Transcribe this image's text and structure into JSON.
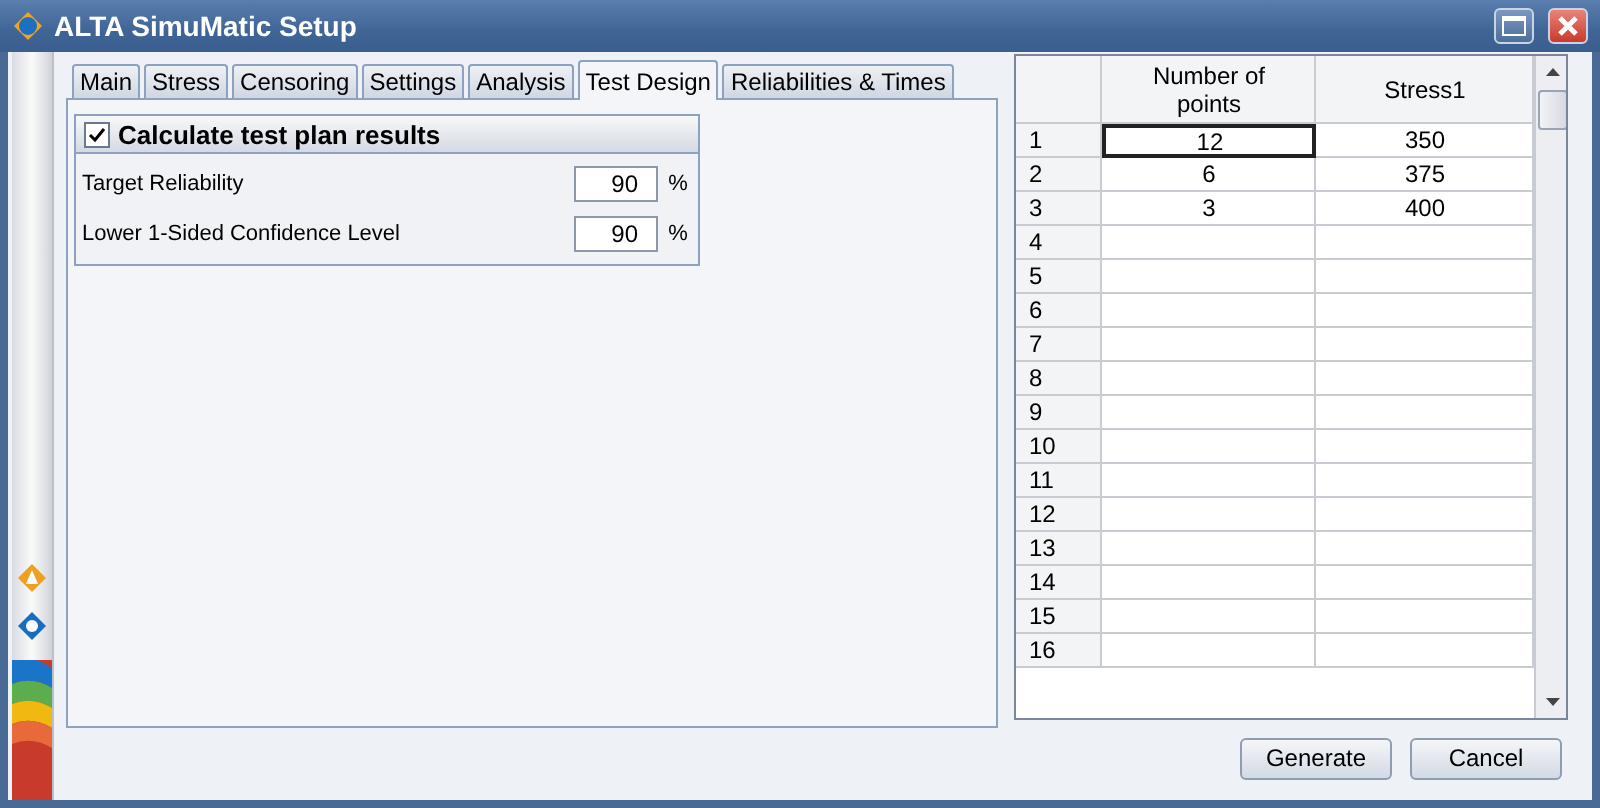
{
  "window": {
    "title": "ALTA SimuMatic Setup"
  },
  "tabs": [
    {
      "label": "Main",
      "selected": false
    },
    {
      "label": "Stress",
      "selected": false
    },
    {
      "label": "Censoring",
      "selected": false
    },
    {
      "label": "Settings",
      "selected": false
    },
    {
      "label": "Analysis",
      "selected": false
    },
    {
      "label": "Test Design",
      "selected": true
    },
    {
      "label": "Reliabilities & Times",
      "selected": false
    }
  ],
  "group": {
    "title": "Calculate test plan results",
    "checked": true,
    "fields": [
      {
        "label": "Target Reliability",
        "value": "90",
        "unit": "%"
      },
      {
        "label": "Lower 1-Sided Confidence Level",
        "value": "90",
        "unit": "%"
      }
    ]
  },
  "table": {
    "columns": [
      "Number of points",
      "Stress1"
    ],
    "rows": [
      {
        "number": "1",
        "cells": [
          {
            "text": "12",
            "selected": true
          },
          {
            "text": "350",
            "selected": false
          }
        ]
      },
      {
        "number": "2",
        "cells": [
          {
            "text": "6",
            "selected": false
          },
          {
            "text": "375",
            "selected": false
          }
        ]
      },
      {
        "number": "3",
        "cells": [
          {
            "text": "3",
            "selected": false
          },
          {
            "text": "400",
            "selected": false
          }
        ]
      },
      {
        "number": "4",
        "cells": [
          {
            "selected": false
          },
          {
            "selected": false
          }
        ]
      },
      {
        "number": "5",
        "cells": [
          {
            "selected": false
          },
          {
            "selected": false
          }
        ]
      },
      {
        "number": "6",
        "cells": [
          {
            "selected": false
          },
          {
            "selected": false
          }
        ]
      },
      {
        "number": "7",
        "cells": [
          {
            "selected": false
          },
          {
            "selected": false
          }
        ]
      },
      {
        "number": "8",
        "cells": [
          {
            "selected": false
          },
          {
            "selected": false
          }
        ]
      },
      {
        "number": "9",
        "cells": [
          {
            "selected": false
          },
          {
            "selected": false
          }
        ]
      },
      {
        "number": "10",
        "cells": [
          {
            "selected": false
          },
          {
            "selected": false
          }
        ]
      },
      {
        "number": "11",
        "cells": [
          {
            "selected": false
          },
          {
            "selected": false
          }
        ]
      },
      {
        "number": "12",
        "cells": [
          {
            "selected": false
          },
          {
            "selected": false
          }
        ]
      },
      {
        "number": "13",
        "cells": [
          {
            "selected": false
          },
          {
            "selected": false
          }
        ]
      },
      {
        "number": "14",
        "cells": [
          {
            "selected": false
          },
          {
            "selected": false
          }
        ]
      },
      {
        "number": "15",
        "cells": [
          {
            "selected": false
          },
          {
            "selected": false
          }
        ]
      },
      {
        "number": "16",
        "cells": [
          {
            "selected": false
          },
          {
            "selected": false
          }
        ]
      }
    ]
  },
  "buttons": [
    "Generate",
    "Cancel"
  ]
}
